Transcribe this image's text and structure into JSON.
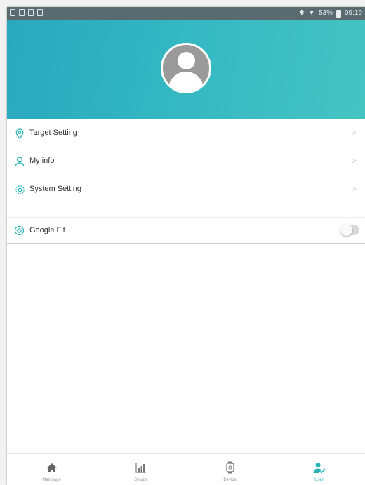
{
  "status_bar": {
    "battery": "53%",
    "time": "09:19"
  },
  "menu": {
    "items": [
      {
        "label": "Target Setting",
        "icon": "location-pin-icon"
      },
      {
        "label": "My info",
        "icon": "person-icon"
      },
      {
        "label": "System Setting",
        "icon": "gear-icon"
      }
    ],
    "chevron": ">"
  },
  "google_fit": {
    "label": "Google Fit",
    "icon": "google-fit-icon",
    "enabled": false
  },
  "bottom_nav": {
    "tabs": [
      {
        "label": "Mainpage",
        "icon": "home-icon"
      },
      {
        "label": "Details",
        "icon": "bar-chart-icon"
      },
      {
        "label": "Device",
        "icon": "watch-icon"
      },
      {
        "label": "User",
        "icon": "user-icon"
      }
    ],
    "active": "User"
  },
  "colors": {
    "accent": "#2ab3b5",
    "header_start": "#2aa8bf",
    "header_end": "#45c4c2",
    "status_bar": "#5a6b70"
  }
}
